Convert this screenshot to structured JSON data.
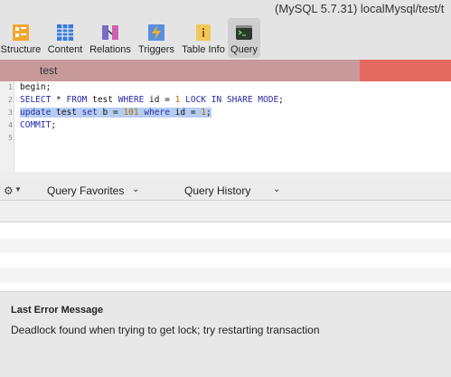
{
  "window": {
    "title": "(MySQL 5.7.31) localMysql/test/t"
  },
  "toolbar": {
    "items": [
      {
        "label": "Structure",
        "icon": "structure-icon",
        "color": "#f0a830"
      },
      {
        "label": "Content",
        "icon": "content-icon",
        "color": "#3d7bd8"
      },
      {
        "label": "Relations",
        "icon": "relations-icon",
        "color": "#7a6cc7"
      },
      {
        "label": "Triggers",
        "icon": "triggers-icon",
        "color": "#e8a23a"
      },
      {
        "label": "Table Info",
        "icon": "table-info-icon",
        "color": "#f2c75a"
      },
      {
        "label": "Query",
        "icon": "query-icon",
        "color": "#2c3a2c",
        "active": true
      }
    ]
  },
  "tabs": [
    {
      "label": "test",
      "color": "#c79a9a"
    },
    {
      "label": "",
      "color": "#e46a61"
    }
  ],
  "editor": {
    "lines": [
      {
        "num": "1",
        "text": "begin;"
      },
      {
        "num": "2",
        "text": "SELECT * FROM test WHERE id = 1 LOCK IN SHARE MODE;"
      },
      {
        "num": "3",
        "text": "update test set b = 101 where id = 1;",
        "selected": true
      },
      {
        "num": "4",
        "text": "COMMIT;"
      },
      {
        "num": "5",
        "text": ""
      }
    ]
  },
  "query_bar": {
    "favorites_label": "Query Favorites",
    "history_label": "Query History"
  },
  "error": {
    "title": "Last Error Message",
    "message": "Deadlock found when trying to get lock; try restarting transaction"
  }
}
